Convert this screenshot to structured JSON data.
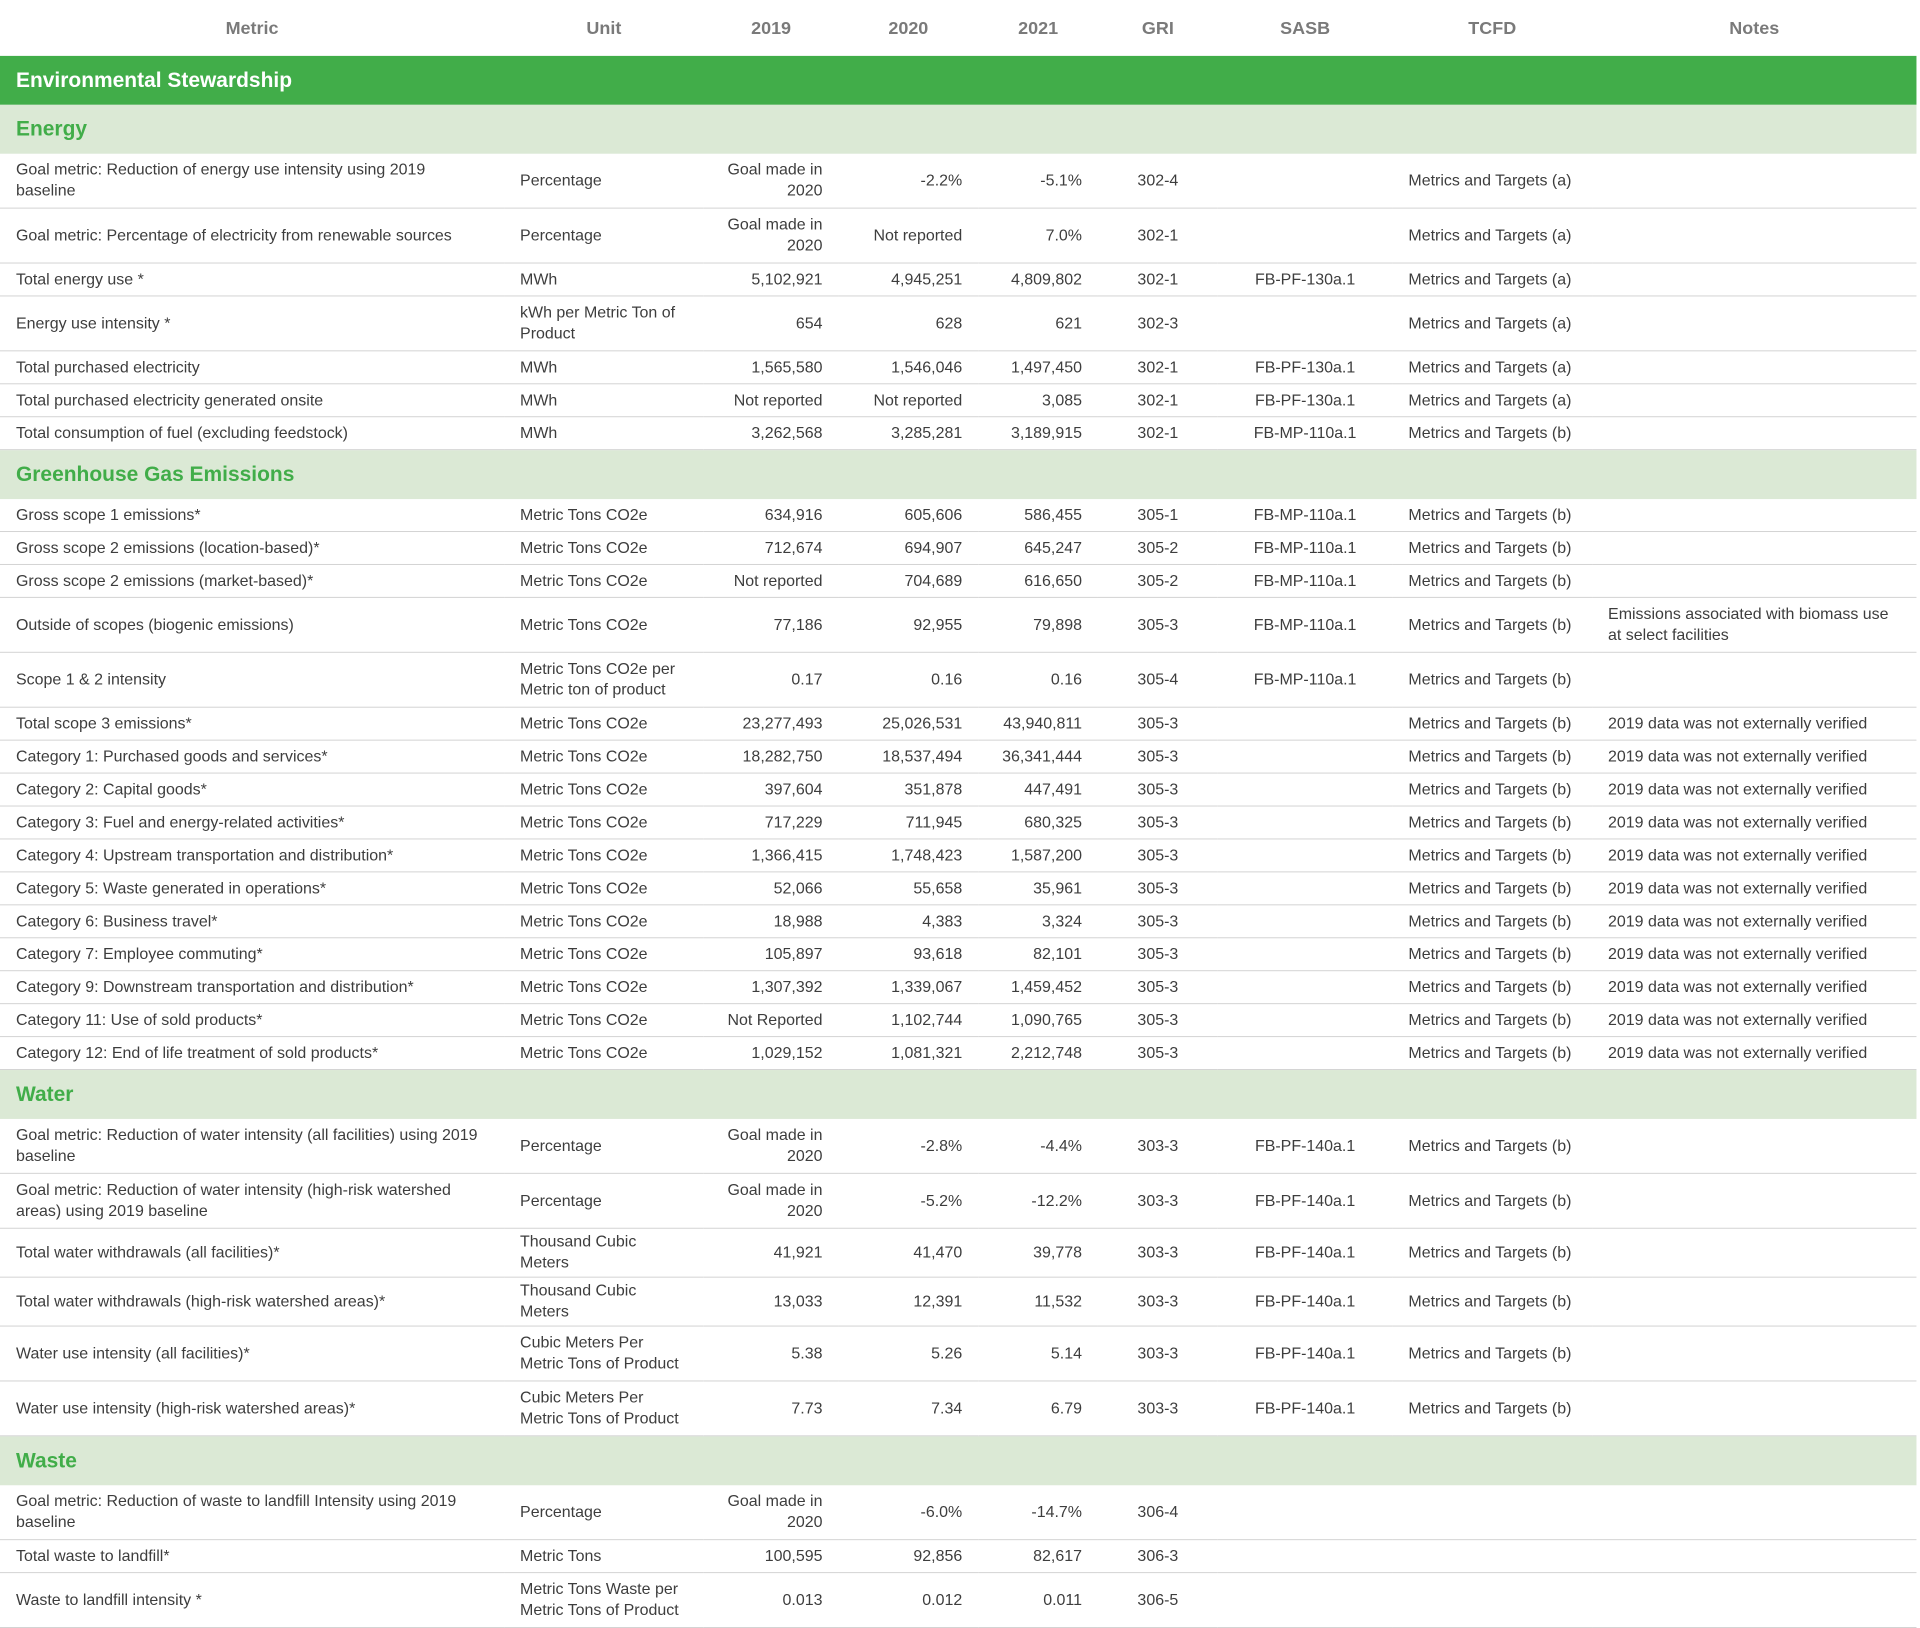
{
  "header": {
    "metric": "Metric",
    "unit": "Unit",
    "y2019": "2019",
    "y2020": "2020",
    "y2021": "2021",
    "gri": "GRI",
    "sasb": "SASB",
    "tcfd": "TCFD",
    "notes": "Notes"
  },
  "category": "Environmental Stewardship",
  "sections": [
    {
      "title": "Energy",
      "rows": [
        {
          "metric": "Goal metric: Reduction of energy use intensity using 2019 baseline",
          "unit": "Percentage",
          "y2019": "Goal made in 2020",
          "y2020": "-2.2%",
          "y2021": "-5.1%",
          "gri": "302-4",
          "sasb": "",
          "tcfd": "Metrics and Targets (a)",
          "notes": ""
        },
        {
          "metric": "Goal metric: Percentage of electricity from renewable sources",
          "unit": "Percentage",
          "y2019": "Goal made in 2020",
          "y2020": "Not reported",
          "y2021": "7.0%",
          "gri": "302-1",
          "sasb": "",
          "tcfd": "Metrics and Targets (a)",
          "notes": ""
        },
        {
          "metric": "Total energy use *",
          "unit": "MWh",
          "y2019": "5,102,921",
          "y2020": "4,945,251",
          "y2021": "4,809,802",
          "gri": "302-1",
          "sasb": "FB-PF-130a.1",
          "tcfd": "Metrics and Targets (a)",
          "notes": ""
        },
        {
          "metric": "Energy use intensity *",
          "unit": "kWh per Metric Ton of Product",
          "y2019": "654",
          "y2020": "628",
          "y2021": "621",
          "gri": "302-3",
          "sasb": "",
          "tcfd": "Metrics and Targets (a)",
          "notes": ""
        },
        {
          "metric": "Total purchased electricity",
          "unit": "MWh",
          "y2019": "1,565,580",
          "y2020": "1,546,046",
          "y2021": "1,497,450",
          "gri": "302-1",
          "sasb": "FB-PF-130a.1",
          "tcfd": "Metrics and Targets (a)",
          "notes": ""
        },
        {
          "metric": "Total purchased electricity generated onsite",
          "unit": "MWh",
          "y2019": "Not reported",
          "y2020": "Not reported",
          "y2021": "3,085",
          "gri": "302-1",
          "sasb": "FB-PF-130a.1",
          "tcfd": "Metrics and Targets (a)",
          "notes": ""
        },
        {
          "metric": "Total consumption of fuel (excluding feedstock)",
          "unit": "MWh",
          "y2019": "3,262,568",
          "y2020": "3,285,281",
          "y2021": "3,189,915",
          "gri": "302-1",
          "sasb": "FB-MP-110a.1",
          "tcfd": "Metrics and Targets (b)",
          "notes": ""
        }
      ]
    },
    {
      "title": "Greenhouse Gas Emissions",
      "rows": [
        {
          "metric": "Gross scope 1 emissions*",
          "unit": "Metric Tons CO2e",
          "y2019": "634,916",
          "y2020": "605,606",
          "y2021": "586,455",
          "gri": "305-1",
          "sasb": "FB-MP-110a.1",
          "tcfd": "Metrics and Targets (b)",
          "notes": ""
        },
        {
          "metric": "Gross scope 2 emissions (location-based)*",
          "unit": "Metric Tons CO2e",
          "y2019": "712,674",
          "y2020": "694,907",
          "y2021": "645,247",
          "gri": "305-2",
          "sasb": "FB-MP-110a.1",
          "tcfd": "Metrics and Targets (b)",
          "notes": ""
        },
        {
          "metric": "Gross scope 2 emissions (market-based)*",
          "unit": "Metric Tons CO2e",
          "y2019": "Not reported",
          "y2020": "704,689",
          "y2021": "616,650",
          "gri": "305-2",
          "sasb": "FB-MP-110a.1",
          "tcfd": "Metrics and Targets (b)",
          "notes": ""
        },
        {
          "metric": "Outside of scopes (biogenic emissions)",
          "unit": "Metric Tons CO2e",
          "y2019": "77,186",
          "y2020": "92,955",
          "y2021": "79,898",
          "gri": "305-3",
          "sasb": "FB-MP-110a.1",
          "tcfd": "Metrics and Targets (b)",
          "notes": "Emissions associated with biomass use at select facilities"
        },
        {
          "metric": "Scope 1 & 2 intensity",
          "unit": "Metric Tons CO2e per Metric ton of product",
          "y2019": "0.17",
          "y2020": "0.16",
          "y2021": "0.16",
          "gri": "305-4",
          "sasb": "FB-MP-110a.1",
          "tcfd": "Metrics and Targets (b)",
          "notes": ""
        },
        {
          "metric": "Total scope 3 emissions*",
          "unit": "Metric Tons CO2e",
          "y2019": "23,277,493",
          "y2020": "25,026,531",
          "y2021": "43,940,811",
          "gri": "305-3",
          "sasb": "",
          "tcfd": "Metrics and Targets (b)",
          "notes": "2019 data was not  externally verified"
        },
        {
          "metric": "Category 1: Purchased goods and services*",
          "unit": "Metric Tons CO2e",
          "y2019": "18,282,750",
          "y2020": "18,537,494",
          "y2021": "36,341,444",
          "gri": "305-3",
          "sasb": "",
          "tcfd": "Metrics and Targets (b)",
          "notes": "2019 data was not  externally verified"
        },
        {
          "metric": "Category 2: Capital goods*",
          "unit": "Metric Tons CO2e",
          "y2019": "397,604",
          "y2020": "351,878",
          "y2021": "447,491",
          "gri": "305-3",
          "sasb": "",
          "tcfd": "Metrics and Targets (b)",
          "notes": "2019 data was not  externally verified"
        },
        {
          "metric": "Category 3: Fuel and energy-related activities*",
          "unit": "Metric Tons CO2e",
          "y2019": "717,229",
          "y2020": "711,945",
          "y2021": "680,325",
          "gri": "305-3",
          "sasb": "",
          "tcfd": "Metrics and Targets (b)",
          "notes": "2019 data was not  externally verified"
        },
        {
          "metric": "Category 4: Upstream transportation and distribution*",
          "unit": "Metric Tons CO2e",
          "y2019": "1,366,415",
          "y2020": "1,748,423",
          "y2021": "1,587,200",
          "gri": "305-3",
          "sasb": "",
          "tcfd": "Metrics and Targets (b)",
          "notes": "2019 data was not  externally verified"
        },
        {
          "metric": "Category 5: Waste generated in operations*",
          "unit": "Metric Tons CO2e",
          "y2019": "52,066",
          "y2020": "55,658",
          "y2021": "35,961",
          "gri": "305-3",
          "sasb": "",
          "tcfd": "Metrics and Targets (b)",
          "notes": "2019 data was not  externally verified"
        },
        {
          "metric": "Category 6: Business travel*",
          "unit": "Metric Tons CO2e",
          "y2019": "18,988",
          "y2020": "4,383",
          "y2021": "3,324",
          "gri": "305-3",
          "sasb": "",
          "tcfd": "Metrics and Targets (b)",
          "notes": "2019 data was not  externally verified"
        },
        {
          "metric": "Category 7: Employee commuting*",
          "unit": "Metric Tons CO2e",
          "y2019": "105,897",
          "y2020": "93,618",
          "y2021": "82,101",
          "gri": "305-3",
          "sasb": "",
          "tcfd": "Metrics and Targets (b)",
          "notes": "2019 data was not  externally verified"
        },
        {
          "metric": "Category 9: Downstream transportation and distribution*",
          "unit": "Metric Tons CO2e",
          "y2019": "1,307,392",
          "y2020": "1,339,067",
          "y2021": "1,459,452",
          "gri": "305-3",
          "sasb": "",
          "tcfd": "Metrics and Targets (b)",
          "notes": "2019 data was not  externally verified"
        },
        {
          "metric": "Category 11: Use of sold products*",
          "unit": "Metric Tons CO2e",
          "y2019": "Not Reported",
          "y2020": "1,102,744",
          "y2021": "1,090,765",
          "gri": "305-3",
          "sasb": "",
          "tcfd": "Metrics and Targets (b)",
          "notes": "2019 data was not  externally verified"
        },
        {
          "metric": "Category 12: End of life treatment of sold products*",
          "unit": "Metric Tons CO2e",
          "y2019": "1,029,152",
          "y2020": "1,081,321",
          "y2021": "2,212,748",
          "gri": "305-3",
          "sasb": "",
          "tcfd": "Metrics and Targets (b)",
          "notes": "2019 data was not  externally verified"
        }
      ]
    },
    {
      "title": "Water",
      "rows": [
        {
          "metric": "Goal metric: Reduction of water intensity (all facilities) using 2019 baseline",
          "unit": "Percentage",
          "y2019": "Goal made in 2020",
          "y2020": "-2.8%",
          "y2021": "-4.4%",
          "gri": "303-3",
          "sasb": "FB-PF-140a.1",
          "tcfd": "Metrics and Targets (b)",
          "notes": ""
        },
        {
          "metric": "Goal metric: Reduction of water intensity (high-risk watershed areas) using 2019 baseline",
          "unit": "Percentage",
          "y2019": "Goal made in 2020",
          "y2020": "-5.2%",
          "y2021": "-12.2%",
          "gri": "303-3",
          "sasb": "FB-PF-140a.1",
          "tcfd": "Metrics and Targets (b)",
          "notes": ""
        },
        {
          "metric": "Total water withdrawals (all facilities)*",
          "unit": "Thousand Cubic Meters",
          "y2019": "41,921",
          "y2020": "41,470",
          "y2021": "39,778",
          "gri": "303-3",
          "sasb": "FB-PF-140a.1",
          "tcfd": "Metrics and Targets (b)",
          "notes": ""
        },
        {
          "metric": "Total water withdrawals (high-risk watershed areas)*",
          "unit": "Thousand Cubic Meters",
          "y2019": "13,033",
          "y2020": "12,391",
          "y2021": "11,532",
          "gri": "303-3",
          "sasb": "FB-PF-140a.1",
          "tcfd": "Metrics and Targets (b)",
          "notes": ""
        },
        {
          "metric": "Water use intensity (all facilities)*",
          "unit": "Cubic Meters Per Metric Tons of Product",
          "y2019": "5.38",
          "y2020": "5.26",
          "y2021": "5.14",
          "gri": "303-3",
          "sasb": "FB-PF-140a.1",
          "tcfd": "Metrics and Targets (b)",
          "notes": ""
        },
        {
          "metric": "Water use intensity (high-risk watershed areas)*",
          "unit": "Cubic Meters Per Metric Tons of Product",
          "y2019": "7.73",
          "y2020": "7.34",
          "y2021": "6.79",
          "gri": "303-3",
          "sasb": "FB-PF-140a.1",
          "tcfd": "Metrics and Targets (b)",
          "notes": ""
        }
      ]
    },
    {
      "title": "Waste",
      "rows": [
        {
          "metric": "Goal metric: Reduction of waste to landfill Intensity using 2019 baseline",
          "unit": "Percentage",
          "y2019": "Goal made in 2020",
          "y2020": "-6.0%",
          "y2021": "-14.7%",
          "gri": "306-4",
          "sasb": "",
          "tcfd": "",
          "notes": ""
        },
        {
          "metric": "Total waste to landfill*",
          "unit": "Metric Tons",
          "y2019": "100,595",
          "y2020": "92,856",
          "y2021": "82,617",
          "gri": "306-3",
          "sasb": "",
          "tcfd": "",
          "notes": ""
        },
        {
          "metric": "Waste to landfill intensity *",
          "unit": "Metric Tons Waste per Metric Tons of Product",
          "y2019": "0.013",
          "y2020": "0.012",
          "y2021": "0.011",
          "gri": "306-5",
          "sasb": "",
          "tcfd": "",
          "notes": ""
        }
      ]
    }
  ]
}
